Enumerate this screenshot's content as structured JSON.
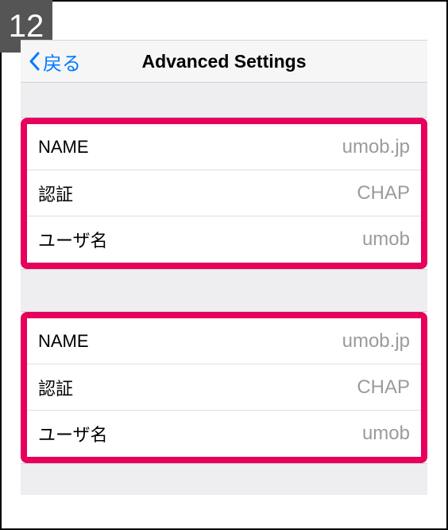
{
  "step": "12",
  "nav": {
    "back_label": "戻る",
    "title": "Advanced Settings"
  },
  "groups": [
    {
      "rows": [
        {
          "label": "NAME",
          "value": "umob.jp"
        },
        {
          "label": "認証",
          "value": "CHAP"
        },
        {
          "label": "ユーザ名",
          "value": "umob"
        }
      ]
    },
    {
      "rows": [
        {
          "label": "NAME",
          "value": "umob.jp"
        },
        {
          "label": "認証",
          "value": "CHAP"
        },
        {
          "label": "ユーザ名",
          "value": "umob"
        }
      ]
    }
  ]
}
